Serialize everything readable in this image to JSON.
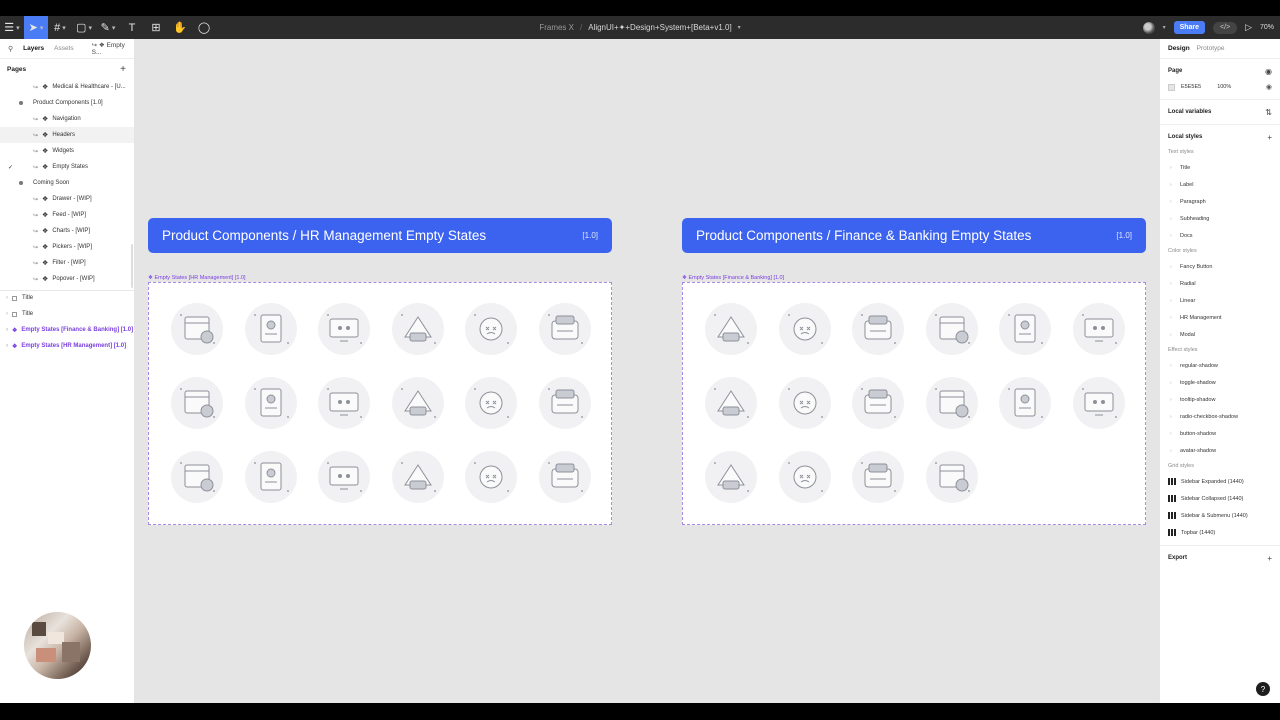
{
  "toolbar": {
    "tools": [
      {
        "name": "main-menu-icon",
        "glyph": "☰"
      },
      {
        "name": "move-tool-icon",
        "glyph": "➤"
      },
      {
        "name": "frame-tool-icon",
        "glyph": "#"
      },
      {
        "name": "shape-tool-icon",
        "glyph": "▢"
      },
      {
        "name": "pen-tool-icon",
        "glyph": "✎"
      },
      {
        "name": "text-tool-icon",
        "glyph": "T"
      },
      {
        "name": "resources-icon",
        "glyph": "⊞"
      },
      {
        "name": "hand-tool-icon",
        "glyph": "✋"
      },
      {
        "name": "comment-tool-icon",
        "glyph": "◯"
      }
    ],
    "project": "Frames X",
    "separator": "/",
    "file_name": "AlignUI+✦+Design+System+[Beta+v1.0]",
    "share_label": "Share",
    "dev_mode_glyph": "</>",
    "play_glyph": "▷",
    "zoom": "70%"
  },
  "left": {
    "tab_layers": "Layers",
    "tab_assets": "Assets",
    "page_selector": "↪ ❖ Empty S...",
    "pages_title": "Pages",
    "pages_add": "+",
    "rows": [
      {
        "text": "Medical & Healthcare - [U...",
        "indent": 33,
        "kind": "page-comp"
      },
      {
        "text": "Product Components [1.0]",
        "indent": 33,
        "kind": "section"
      },
      {
        "text": "Navigation",
        "indent": 33,
        "kind": "page-comp"
      },
      {
        "text": "Headers",
        "indent": 33,
        "kind": "page-comp",
        "highlight": true
      },
      {
        "text": "Widgets",
        "indent": 33,
        "kind": "page-comp"
      },
      {
        "text": "Empty States",
        "indent": 33,
        "kind": "page-comp",
        "checked": true
      },
      {
        "text": "Coming Soon",
        "indent": 33,
        "kind": "section"
      },
      {
        "text": "Drawer - [WIP]",
        "indent": 33,
        "kind": "page-comp"
      },
      {
        "text": "Feed - [WIP]",
        "indent": 33,
        "kind": "page-comp"
      },
      {
        "text": "Charts - [WIP]",
        "indent": 33,
        "kind": "page-comp"
      },
      {
        "text": "Pickers - [WIP]",
        "indent": 33,
        "kind": "page-comp"
      },
      {
        "text": "Filter - [WIP]",
        "indent": 33,
        "kind": "page-comp"
      },
      {
        "text": "Popover - [WIP]",
        "indent": 33,
        "kind": "page-comp"
      }
    ],
    "layers": [
      {
        "text": "Title",
        "kind": "frame"
      },
      {
        "text": "Title",
        "kind": "frame"
      },
      {
        "text": "Empty States [Finance & Banking] [1.0]",
        "kind": "purple"
      },
      {
        "text": "Empty States [HR Management] [1.0]",
        "kind": "purple"
      }
    ]
  },
  "canvas": {
    "hr": {
      "banner_title": "Product Components / HR Management Empty States",
      "banner_version": "[1.0]",
      "frame_label": "❖ Empty States [HR Management] [1.0]",
      "illustrations": [
        "calendar",
        "id-card",
        "monitor-chat",
        "scroll-code",
        "calendar-note",
        "cocktail-face",
        "sun-beach-chair",
        "profile-settings",
        "chat-heart",
        "gift-box",
        "laptop-clock",
        "documents-face",
        "stopwatch-broken",
        "id-badge-stack",
        "browser-card",
        "folders",
        "book-face",
        "presentation"
      ]
    },
    "finance": {
      "banner_title": "Product Components / Finance & Banking Empty States",
      "banner_version": "[1.0]",
      "frame_label": "❖ Empty States [Finance & Banking] [1.0]",
      "illustrations": [
        "chart-board",
        "wallet-cards",
        "gauge",
        "monitor-coin",
        "briefcase-coins",
        "calculator-pie",
        "clipboard-coin",
        "transfer-arrows",
        "laptop-camera",
        "connected-coins",
        "piggy-jar",
        "card-folder",
        "receipt-roll",
        "phone-safe",
        "wallet-face",
        "shield-house"
      ]
    }
  },
  "right": {
    "tab_design": "Design",
    "tab_prototype": "Prototype",
    "page_title": "Page",
    "page_color": "E5E5E5",
    "page_opacity": "100%",
    "local_variables": "Local variables",
    "local_styles": "Local styles",
    "text_styles_title": "Text styles",
    "text_styles": [
      "Title",
      "Label",
      "Paragraph",
      "Subheading",
      "Docs"
    ],
    "color_styles_title": "Color styles",
    "color_styles": [
      "Fancy Button",
      "Radial",
      "Linear",
      "HR Management",
      "Modal"
    ],
    "effect_styles_title": "Effect styles",
    "effect_styles": [
      "regular-shadow",
      "toggle-shadow",
      "tooltip-shadow",
      "radio-checkbox-shadow",
      "button-shadow",
      "avatar-shadow"
    ],
    "grid_styles_title": "Grid styles",
    "grid_styles": [
      "Sidebar Expanded (1440)",
      "Sidebar Collapsed (1440)",
      "Sidebar & Submenu (1440)",
      "Topbar (1440)"
    ],
    "export": "Export",
    "help": "?"
  },
  "colors": {
    "accent": "#4a7cf6",
    "banner": "#3c63f0",
    "purple": "#7b3fe0",
    "canvas": "#e5e5e5"
  }
}
